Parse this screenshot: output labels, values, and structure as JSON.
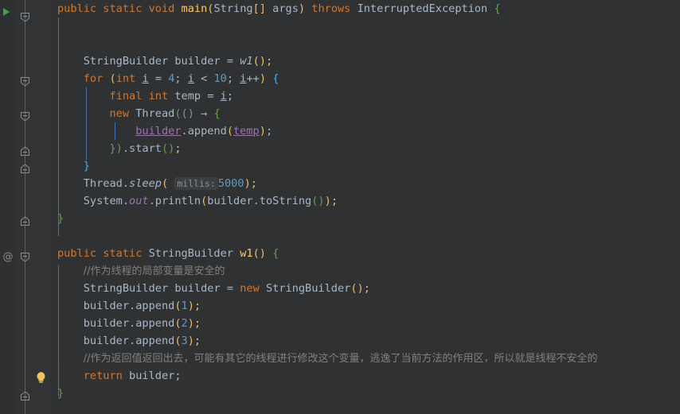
{
  "editor": {
    "theme": "darcula",
    "background": "#2F3133",
    "gutter_background": "#313335",
    "caret_line_background": "#323232",
    "font_size_px": 13.6,
    "line_height_px": 22,
    "language": "Java"
  },
  "colors": {
    "keyword": "#CC7832",
    "number": "#6897BB",
    "comment": "#808080",
    "method_declaration": "#FFC66D",
    "static_field": "#9876AA",
    "identifier": "#A9B7C6",
    "bracket_yellow": "#E8BF6A",
    "bracket_green": "#6A9E56",
    "bracket_blue": "#4EADE5",
    "indent_guide": "#4B5052",
    "indent_guide_active": "#5E7F3E",
    "inlay_hint_background": "#3C3F41",
    "run_marker_green": "#499C54",
    "bulb_yellow": "#F2C55C"
  },
  "gutter": {
    "run_marker_line": 1,
    "annotation_marker_label": "@",
    "annotation_marker_line": 15,
    "intention_bulb_line": 21,
    "fold_markers": [
      {
        "line": 1,
        "state": "expanded"
      },
      {
        "line": 5,
        "state": "expanded"
      },
      {
        "line": 7,
        "state": "expanded"
      },
      {
        "line": 9,
        "state": "collapsed-end"
      },
      {
        "line": 10,
        "state": "collapsed-end"
      },
      {
        "line": 13,
        "state": "collapsed-end"
      },
      {
        "line": 15,
        "state": "expanded"
      },
      {
        "line": 22,
        "state": "collapsed-end"
      }
    ]
  },
  "code": {
    "inlay_hints": [
      {
        "line": 11,
        "label": "millis:"
      }
    ],
    "lines": [
      {
        "n": 1,
        "text": "public static void main(String[] args) throws InterruptedException {"
      },
      {
        "n": 2,
        "text": ""
      },
      {
        "n": 3,
        "text": ""
      },
      {
        "n": 4,
        "text": "    StringBuilder builder = w1();"
      },
      {
        "n": 5,
        "text": "    for (int i = 4; i < 10; i++) {"
      },
      {
        "n": 6,
        "text": "        final int temp = i;"
      },
      {
        "n": 7,
        "text": "        new Thread(() -> {"
      },
      {
        "n": 8,
        "text": "            builder.append(temp);"
      },
      {
        "n": 9,
        "text": "        }).start();"
      },
      {
        "n": 10,
        "text": "    }"
      },
      {
        "n": 11,
        "text": "    Thread.sleep( millis: 5000);"
      },
      {
        "n": 12,
        "text": "    System.out.println(builder.toString());"
      },
      {
        "n": 13,
        "text": "}"
      },
      {
        "n": 14,
        "text": ""
      },
      {
        "n": 15,
        "text": "public static StringBuilder w1() {"
      },
      {
        "n": 16,
        "text": "    //作为线程的局部变量是安全的"
      },
      {
        "n": 17,
        "text": "    StringBuilder builder = new StringBuilder();"
      },
      {
        "n": 18,
        "text": "    builder.append(1);"
      },
      {
        "n": 19,
        "text": "    builder.append(2);"
      },
      {
        "n": 20,
        "text": "    builder.append(3);"
      },
      {
        "n": 21,
        "text": "    //作为返回值返回出去，可能有其它的线程进行修改这个变量，逃逸了当前方法的作用区，所以就是线程不安全的"
      },
      {
        "n": 22,
        "text": "    return builder;"
      },
      {
        "n": 23,
        "text": "}"
      }
    ],
    "caret_line": 22,
    "tokens": {
      "l1": {
        "k1": "public",
        "k2": "static",
        "k3": "void",
        "name": "main",
        "lp": "(",
        "t1": "String",
        "br": "[]",
        "sp": " ",
        "arg": "args",
        "rp": ")",
        "k4": "throws",
        "ex": "InterruptedException",
        "brace": "{"
      },
      "l4": {
        "type": "StringBuilder",
        "var": "builder",
        "eq": "=",
        "call": "w1",
        "parens": "();"
      },
      "l5": {
        "kw": "for",
        "lp": "(",
        "int": "int",
        "i1": "i",
        "eq1": "= ",
        "n1": "4",
        "sc1": "; ",
        "i2": "i",
        "lt": "< ",
        "n2": "10",
        "sc2": "; ",
        "i3": "i",
        "inc": "++",
        "rp": ")",
        "brace": "{"
      },
      "l6": {
        "kw1": "final",
        "kw2": "int",
        "var": "temp",
        "eq": "= ",
        "i": "i",
        "sc": ";"
      },
      "l7": {
        "kw": "new",
        "cls": "Thread",
        "lp1": "(",
        "lp2": "()",
        "arrow": "→",
        "brace": "{"
      },
      "l8": {
        "field": "builder",
        "dot": ".",
        "meth": "append",
        "lp": "(",
        "param": "temp",
        "rp": ")",
        "sc": ";"
      },
      "l9": {
        "brace": "}",
        "rp": ")",
        "dot": ".",
        "meth": "start",
        "parens": "()",
        "sc": ";"
      },
      "l10": {
        "brace": "}"
      },
      "l11": {
        "cls": "Thread",
        "dot": ".",
        "meth": "sleep",
        "lp": "(",
        "hint": "millis:",
        "n": "5000",
        "rp": ")",
        "sc": ";"
      },
      "l12": {
        "cls": "System",
        "dot1": ".",
        "field": "out",
        "dot2": ".",
        "meth": "println",
        "lp": "(",
        "arg": "builder",
        "dot3": ".",
        "meth2": "toString",
        "parens": "()",
        "rp": ")",
        "sc": ";"
      },
      "l13": {
        "brace": "}"
      },
      "l15": {
        "k1": "public",
        "k2": "static",
        "ret": "StringBuilder",
        "name": "w1",
        "parens": "()",
        "brace": "{"
      },
      "l16": {
        "comment": "//作为线程的局部变量是安全的"
      },
      "l17": {
        "type": "StringBuilder",
        "var": "builder",
        "eq": "=",
        "kw": "new",
        "ctor": "StringBuilder",
        "parens": "();"
      },
      "l18": {
        "var": "builder",
        "dot": ".",
        "meth": "append",
        "lp": "(",
        "n": "1",
        "rp": ")",
        "sc": ";"
      },
      "l19": {
        "var": "builder",
        "dot": ".",
        "meth": "append",
        "lp": "(",
        "n": "2",
        "rp": ")",
        "sc": ";"
      },
      "l20": {
        "var": "builder",
        "dot": ".",
        "meth": "append",
        "lp": "(",
        "n": "3",
        "rp": ")",
        "sc": ";"
      },
      "l21": {
        "comment": "//作为返回值返回出去，可能有其它的线程进行修改这个变量，逃逸了当前方法的作用区，所以就是线程不安全的"
      },
      "l22": {
        "kw": "return",
        "var": "builder",
        "sc": ";"
      },
      "l23": {
        "brace": "}"
      }
    }
  }
}
